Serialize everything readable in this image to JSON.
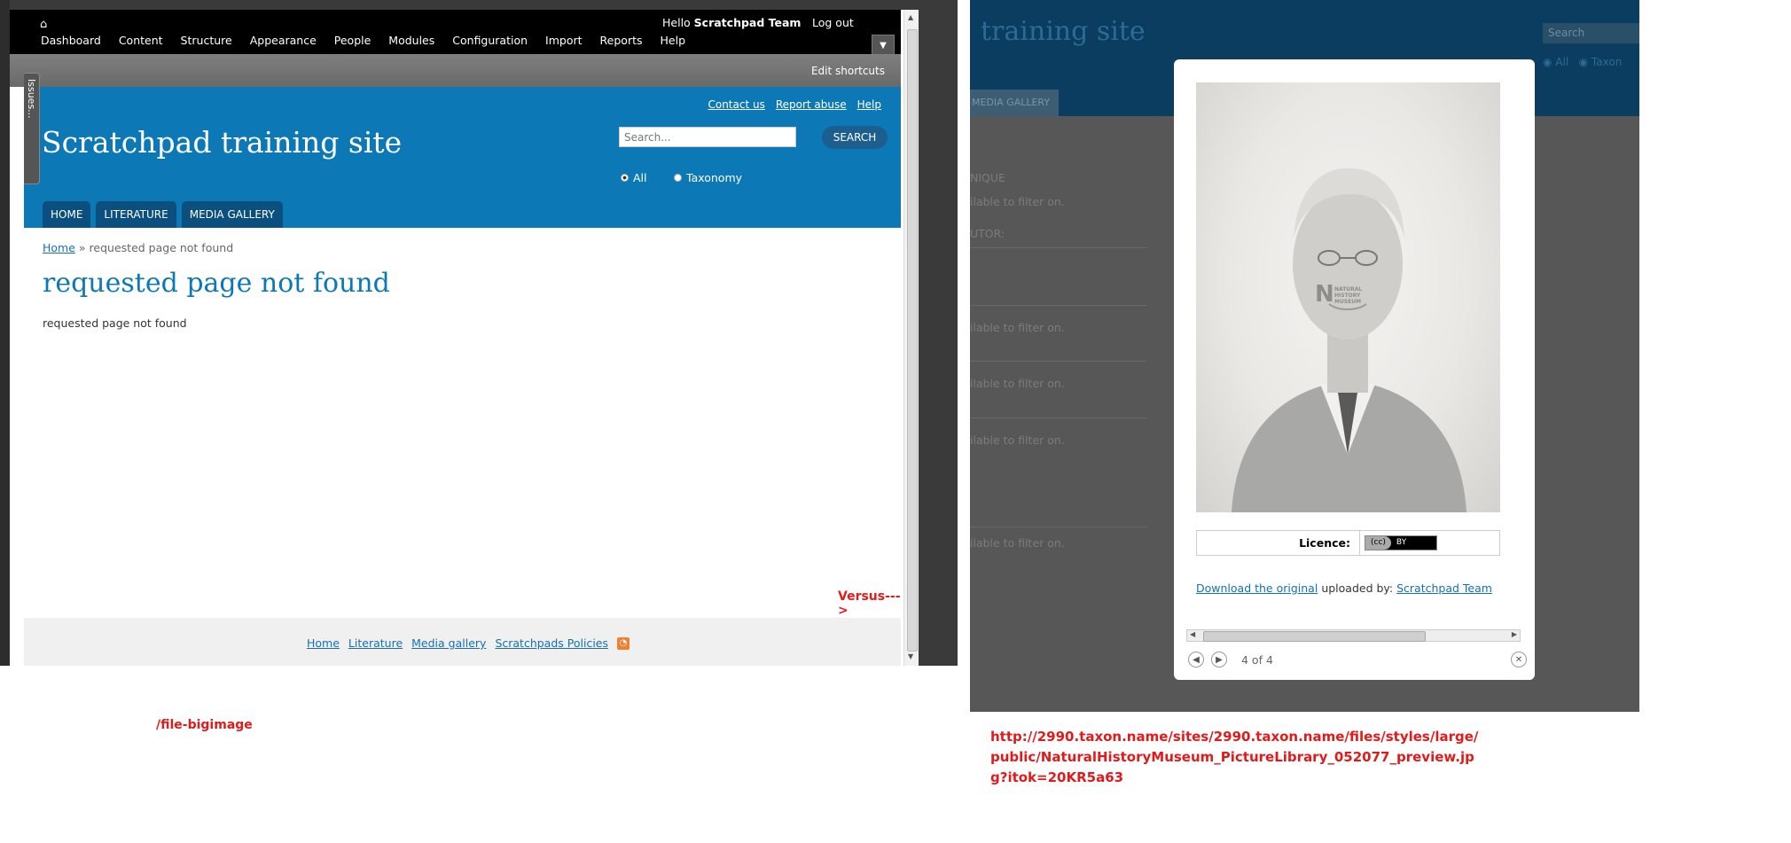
{
  "left": {
    "toolbar": {
      "hello_prefix": "Hello",
      "user_name": "Scratchpad Team",
      "logout": "Log out",
      "menu": [
        "Dashboard",
        "Content",
        "Structure",
        "Appearance",
        "People",
        "Modules",
        "Configuration",
        "Import",
        "Reports",
        "Help"
      ],
      "edit_shortcuts": "Edit shortcuts"
    },
    "issues_tab": "Issues...",
    "header": {
      "links": [
        "Contact us",
        "Report abuse",
        "Help"
      ],
      "site_title": "Scratchpad training site",
      "search_placeholder": "Search...",
      "search_button": "SEARCH",
      "radio_all": "All",
      "radio_taxonomy": "Taxonomy",
      "tabs": [
        "HOME",
        "LITERATURE",
        "MEDIA GALLERY"
      ]
    },
    "content": {
      "breadcrumb_home": "Home",
      "breadcrumb_sep": "»",
      "breadcrumb_current": "requested page not found",
      "title": "requested page not found",
      "body": "requested page not found"
    },
    "versus": "Versus--->",
    "footer": {
      "links": [
        "Home",
        "Literature",
        "Media gallery",
        "Scratchpads Policies"
      ]
    }
  },
  "left_caption": "/file-bigimage",
  "right": {
    "site_title": "training site",
    "search_placeholder": "Search",
    "radio_all": "All",
    "radio_taxonomy": "Taxon",
    "tab": "MEDIA GALLERY",
    "filter_heading_1": "NIQUE",
    "filter_heading_2": "UTOR:",
    "filter_text": "ilable to filter on.",
    "lightbox": {
      "watermark_letter": "N",
      "watermark_text": [
        "NATURAL",
        "HISTORY",
        "MUSEUM"
      ],
      "licence_label": "Licence:",
      "licence_badge": [
        "(cc)",
        "BY"
      ],
      "download_link": "Download the original",
      "uploaded_by": "uploaded by:",
      "uploader": "Scratchpad Team",
      "counter": "4 of 4"
    }
  },
  "right_caption": "http://2990.taxon.name/sites/2990.taxon.name/files/styles/large/public/NaturalHistoryMuseum_PictureLibrary_052077_preview.jpg?itok=20KR5a63",
  "colors": {
    "header_blue": "#0d78b6",
    "caption_red": "#e11b1b",
    "link_blue": "#1570b3"
  }
}
